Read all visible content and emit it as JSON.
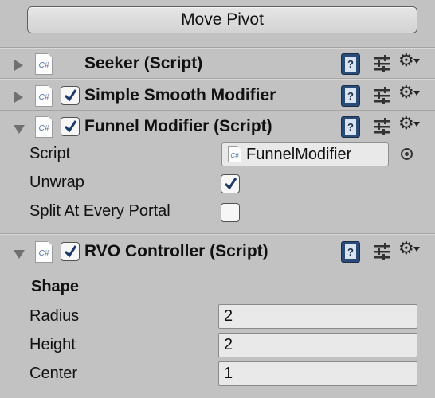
{
  "toolbar": {
    "move_pivot_label": "Move Pivot"
  },
  "components": [
    {
      "title": "Seeker (Script)",
      "expanded": false,
      "has_enable_checkbox": false
    },
    {
      "title": "Simple Smooth Modifier",
      "expanded": false,
      "has_enable_checkbox": true,
      "enabled": true
    },
    {
      "title": "Funnel Modifier (Script)",
      "expanded": true,
      "has_enable_checkbox": true,
      "enabled": true
    },
    {
      "title": "RVO Controller (Script)",
      "expanded": true,
      "has_enable_checkbox": true,
      "enabled": true
    }
  ],
  "icons": {
    "script_file": "C#",
    "help": "help-book-icon",
    "presets": "presets-icon",
    "settings": "gear-icon"
  },
  "funnel": {
    "script_label": "Script",
    "script_value": "FunnelModifier",
    "unwrap_label": "Unwrap",
    "unwrap_checked": true,
    "split_label": "Split At Every Portal",
    "split_checked": false
  },
  "rvo": {
    "section_title": "Shape",
    "radius_label": "Radius",
    "radius_value": "2",
    "height_label": "Height",
    "height_value": "2",
    "center_label": "Center",
    "center_value": "1"
  },
  "colors": {
    "background": "#c2c2c2",
    "checkbox_tick": "#1b3a6b",
    "help_book": "#2a4b78"
  }
}
